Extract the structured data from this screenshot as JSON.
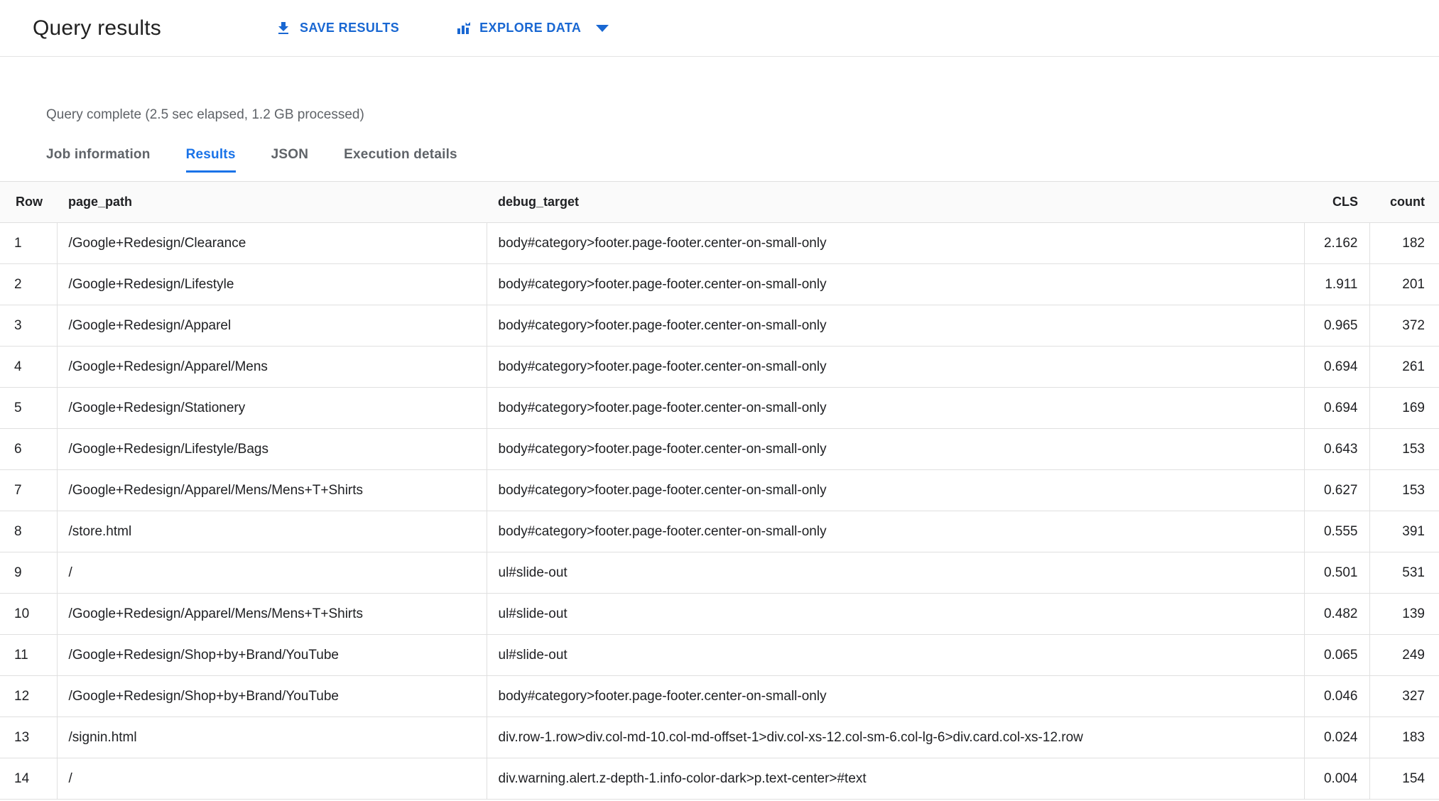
{
  "header": {
    "title": "Query results",
    "save_button": "SAVE RESULTS",
    "explore_button": "EXPLORE DATA"
  },
  "status": "Query complete (2.5 sec elapsed, 1.2 GB processed)",
  "tabs": [
    {
      "label": "Job information",
      "active": false
    },
    {
      "label": "Results",
      "active": true
    },
    {
      "label": "JSON",
      "active": false
    },
    {
      "label": "Execution details",
      "active": false
    }
  ],
  "table": {
    "columns": [
      "Row",
      "page_path",
      "debug_target",
      "CLS",
      "count"
    ],
    "rows": [
      {
        "row": "1",
        "page_path": "/Google+Redesign/Clearance",
        "debug_target": "body#category>footer.page-footer.center-on-small-only",
        "cls": "2.162",
        "count": "182"
      },
      {
        "row": "2",
        "page_path": "/Google+Redesign/Lifestyle",
        "debug_target": "body#category>footer.page-footer.center-on-small-only",
        "cls": "1.911",
        "count": "201"
      },
      {
        "row": "3",
        "page_path": "/Google+Redesign/Apparel",
        "debug_target": "body#category>footer.page-footer.center-on-small-only",
        "cls": "0.965",
        "count": "372"
      },
      {
        "row": "4",
        "page_path": "/Google+Redesign/Apparel/Mens",
        "debug_target": "body#category>footer.page-footer.center-on-small-only",
        "cls": "0.694",
        "count": "261"
      },
      {
        "row": "5",
        "page_path": "/Google+Redesign/Stationery",
        "debug_target": "body#category>footer.page-footer.center-on-small-only",
        "cls": "0.694",
        "count": "169"
      },
      {
        "row": "6",
        "page_path": "/Google+Redesign/Lifestyle/Bags",
        "debug_target": "body#category>footer.page-footer.center-on-small-only",
        "cls": "0.643",
        "count": "153"
      },
      {
        "row": "7",
        "page_path": "/Google+Redesign/Apparel/Mens/Mens+T+Shirts",
        "debug_target": "body#category>footer.page-footer.center-on-small-only",
        "cls": "0.627",
        "count": "153"
      },
      {
        "row": "8",
        "page_path": "/store.html",
        "debug_target": "body#category>footer.page-footer.center-on-small-only",
        "cls": "0.555",
        "count": "391"
      },
      {
        "row": "9",
        "page_path": "/",
        "debug_target": "ul#slide-out",
        "cls": "0.501",
        "count": "531"
      },
      {
        "row": "10",
        "page_path": "/Google+Redesign/Apparel/Mens/Mens+T+Shirts",
        "debug_target": "ul#slide-out",
        "cls": "0.482",
        "count": "139"
      },
      {
        "row": "11",
        "page_path": "/Google+Redesign/Shop+by+Brand/YouTube",
        "debug_target": "ul#slide-out",
        "cls": "0.065",
        "count": "249"
      },
      {
        "row": "12",
        "page_path": "/Google+Redesign/Shop+by+Brand/YouTube",
        "debug_target": "body#category>footer.page-footer.center-on-small-only",
        "cls": "0.046",
        "count": "327"
      },
      {
        "row": "13",
        "page_path": "/signin.html",
        "debug_target": "div.row-1.row>div.col-md-10.col-md-offset-1>div.col-xs-12.col-sm-6.col-lg-6>div.card.col-xs-12.row",
        "cls": "0.024",
        "count": "183"
      },
      {
        "row": "14",
        "page_path": "/",
        "debug_target": "div.warning.alert.z-depth-1.info-color-dark>p.text-center>#text",
        "cls": "0.004",
        "count": "154"
      }
    ]
  },
  "colors": {
    "accent": "#1a73e8",
    "button_blue": "#1967d2",
    "border": "#e0e0e0",
    "header_bg": "#fafafa"
  }
}
